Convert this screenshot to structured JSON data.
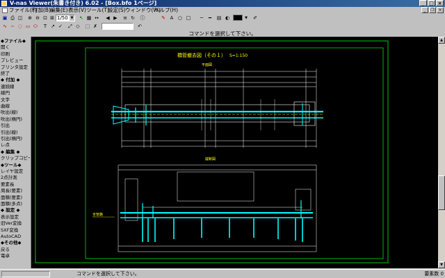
{
  "window": {
    "title": "V-nas Viewer(朱書き付き) 6.02 - [Box.bfo 1ページ]"
  },
  "menu": [
    {
      "label": "ファイル(F)"
    },
    {
      "label": "付加(B)"
    },
    {
      "label": "編集(E)"
    },
    {
      "label": "表示(V)"
    },
    {
      "label": "ツール(T)"
    },
    {
      "label": "設定(S)"
    },
    {
      "label": "ウィンドウ(W)"
    },
    {
      "label": "ヘルプ(H)"
    }
  ],
  "toolbar": {
    "zoom_value": "1/50"
  },
  "command_prompt": "コマンドを選択して下さい。",
  "sidebar": [
    {
      "label": "◆ファイル◆",
      "header": true
    },
    {
      "label": "開く"
    },
    {
      "label": "印刷"
    },
    {
      "label": "プレビュー"
    },
    {
      "label": "プリンタ設定"
    },
    {
      "label": "終了"
    },
    {
      "label": "◆ 付加 ◆",
      "header": true
    },
    {
      "label": "連続線"
    },
    {
      "label": "線円"
    },
    {
      "label": "文字"
    },
    {
      "label": "曲線"
    },
    {
      "label": "吹出(線)"
    },
    {
      "label": "吹出(楕円)"
    },
    {
      "label": "引出"
    },
    {
      "label": "引出(線)"
    },
    {
      "label": "引出(楕円)"
    },
    {
      "label": "レ点"
    },
    {
      "label": "◆ 編集 ◆",
      "header": true
    },
    {
      "label": "クリップコピー"
    },
    {
      "label": "◆ツール◆",
      "header": true
    },
    {
      "label": "レイヤ設定"
    },
    {
      "label": "2点計測"
    },
    {
      "label": "要素長"
    },
    {
      "label": "周長(要素)"
    },
    {
      "label": "面積(要素)"
    },
    {
      "label": "面積(多点)"
    },
    {
      "label": "◆ 設定 ◆",
      "header": true
    },
    {
      "label": "表示設定"
    },
    {
      "label": "旧Ver変換"
    },
    {
      "label": "SXF変換"
    },
    {
      "label": "AutoCAD"
    },
    {
      "label": "◆その他◆",
      "header": true
    },
    {
      "label": "戻る"
    },
    {
      "label": "電卓"
    }
  ],
  "drawing": {
    "title": "橋管撤去図（その１）",
    "scale": "S=1:150",
    "plan_label": "平面図",
    "section_label": "縦断図",
    "side_label": "全管路"
  },
  "status": {
    "message": "コマンドを選択して下さい。",
    "right": "要素数 0"
  },
  "colors": {
    "drawing_outline": "#ffffff",
    "drawing_cyan": "#00ffff",
    "drawing_frame": "#00ff00",
    "drawing_text": "#ffff00",
    "canvas_bg": "#000000"
  }
}
